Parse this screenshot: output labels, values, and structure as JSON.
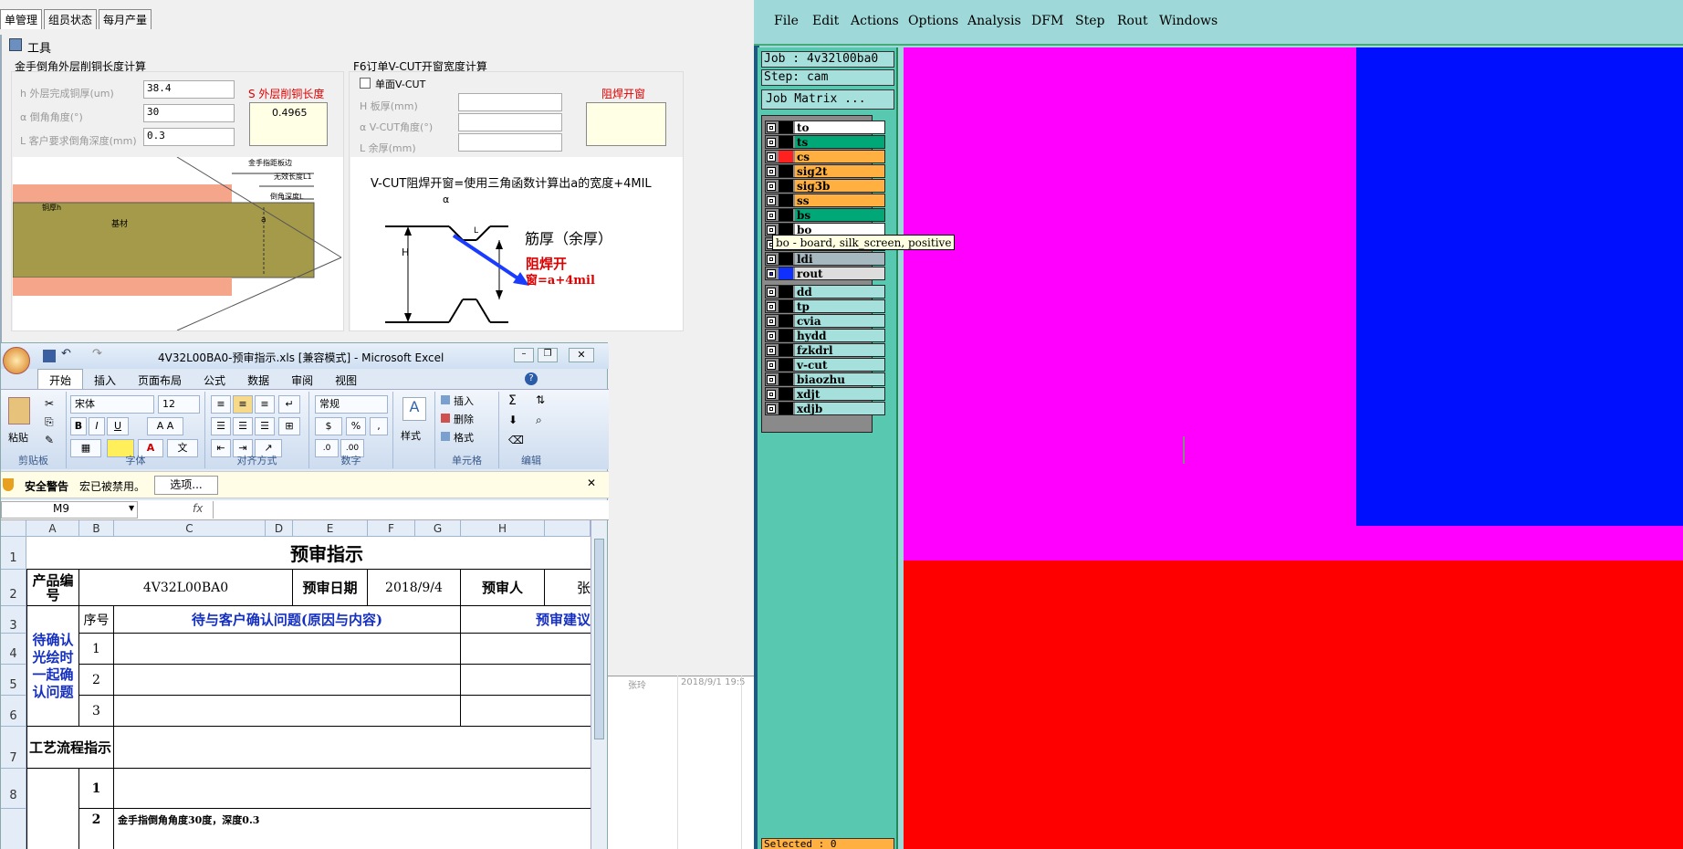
{
  "left_app": {
    "tabs": [
      "单管理",
      "组员状态",
      "每月产量"
    ],
    "tool_window_title": "工具",
    "section1": {
      "title": "金手倒角外层削铜长度计算",
      "field_h_label": "h 外层完成铜厚(um)",
      "field_h_value": "38.4",
      "field_a_label": "α 倒角角度(°)",
      "field_a_value": "30",
      "field_l_label": "L 客户要求倒角深度(mm)",
      "field_l_value": "0.3",
      "result_label": "S 外层削铜长度",
      "result_value": "0.4965",
      "diagram_labels": {
        "top1": "金手指距板边",
        "top2": "无效长度L1",
        "top3": "倒角深度L",
        "left": "铜厚h",
        "center": "基材",
        "angle": "a"
      }
    },
    "section2": {
      "title": "F6订单V-CUT开窗宽度计算",
      "checkbox_label": "单面V-CUT",
      "field_h_label": "H 板厚(mm)",
      "field_a_label": "α V-CUT角度(°)",
      "field_l_label": "L 余厚(mm)",
      "result_label": "阻焊开窗",
      "formula_text": "V-CUT阻焊开窗=使用三角函数计算出a的宽度+4MIL",
      "diagram_note1": "筋厚（余厚）",
      "diagram_note2": "阻焊开",
      "diagram_note3": "窗=a+4mil",
      "dim_labels": {
        "alpha": "α",
        "L": "L",
        "H": "H"
      }
    },
    "background_cells": [
      "张玲",
      "2018/9/1 19:5"
    ]
  },
  "excel": {
    "title": "4V32L00BA0-预审指示.xls  [兼容模式] - Microsoft Excel",
    "ribbon_tabs": [
      "开始",
      "插入",
      "页面布局",
      "公式",
      "数据",
      "审阅",
      "视图"
    ],
    "font_name": "宋体",
    "font_size": "12",
    "number_format": "常规",
    "groups": [
      "剪贴板",
      "字体",
      "对齐方式",
      "数字",
      "单元格",
      "编辑"
    ],
    "paste_label": "粘贴",
    "styles_label": "样式",
    "insert_label": "插入",
    "delete_label": "删除",
    "format_label": "格式",
    "security_title": "安全警告",
    "security_text": "宏已被禁用。",
    "options_button": "选项...",
    "name_box": "M9",
    "columns": [
      "A",
      "B",
      "C",
      "D",
      "E",
      "F",
      "G",
      "H"
    ],
    "rows": [
      "1",
      "2",
      "3",
      "4",
      "5",
      "6",
      "7",
      "8"
    ],
    "sheet": {
      "title": "预审指示",
      "product_label": "产品编号",
      "product_value": "4V32L00BA0",
      "review_date_label": "预审日期",
      "review_date_value": "2018/9/4",
      "reviewer_label": "预审人",
      "reviewer_value": "张",
      "seq_label": "序号",
      "issue_header": "待与客户确认问题(原因与内容)",
      "suggest_header": "预审建议",
      "group_label": "待确认光绘时一起确认问题",
      "seq": [
        "1",
        "2",
        "3"
      ],
      "process_label": "工艺流程指示",
      "process_seq": [
        "1",
        "2"
      ],
      "row9_text": "金手指倒角角度30度，深度0.3"
    }
  },
  "cam": {
    "menu": [
      "File",
      "Edit",
      "Actions",
      "Options",
      "Analysis",
      "DFM",
      "Step",
      "Rout",
      "Windows"
    ],
    "job_label": "Job : 4v32l00ba0",
    "step_label": "Step: cam",
    "job_matrix_button": "Job Matrix ...",
    "selected_label": "Selected : 0",
    "layers_group1": [
      "to",
      "ts",
      "cs",
      "sig2t",
      "sig3b",
      "ss",
      "bs",
      "bo",
      "",
      "ldi",
      "rout"
    ],
    "layers_group2": [
      "dd",
      "tp",
      "cvia",
      "hydd",
      "fzkdrl",
      "v-cut",
      "biaozhu",
      "xdjt",
      "xdjb"
    ],
    "tooltip": "bo - board, silk_screen, positive",
    "colors": {
      "canvas": "#ff00ff",
      "blue_region": "#0010ff",
      "red_region": "#ff0000",
      "panel": "#58c9b0"
    }
  }
}
